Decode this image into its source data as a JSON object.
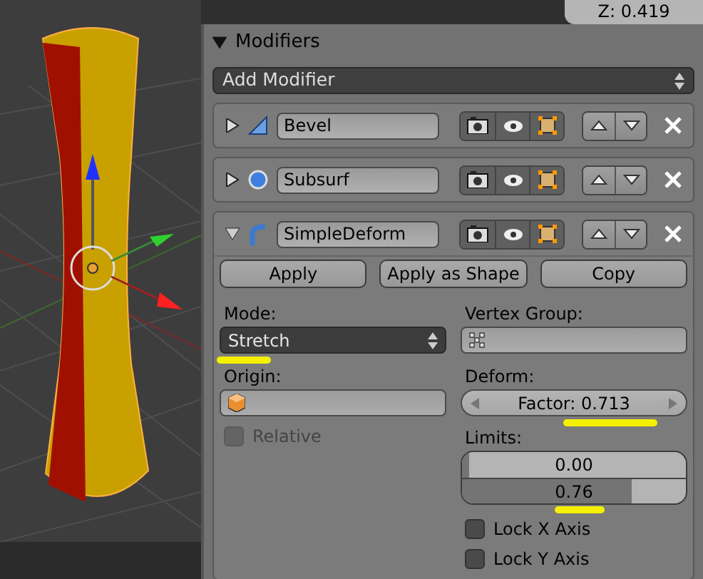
{
  "top_bar": {
    "z_field": "Z: 0.419"
  },
  "panel": {
    "title": "Modifiers",
    "expanded": true,
    "add_button": "Add Modifier",
    "modifiers": [
      {
        "name": "Bevel",
        "kind": "bevel",
        "expanded": false
      },
      {
        "name": "Subsurf",
        "kind": "subsurf",
        "expanded": false
      },
      {
        "name": "SimpleDeform",
        "kind": "deform",
        "expanded": true
      }
    ],
    "actions": [
      "Apply",
      "Apply as Shape",
      "Copy"
    ],
    "mode": {
      "label": "Mode:",
      "value": "Stretch"
    },
    "vertex_group": {
      "label": "Vertex Group:"
    },
    "origin": {
      "label": "Origin:"
    },
    "relative": {
      "label": "Relative",
      "checked": false,
      "disabled": true
    },
    "deform": {
      "label": "Deform:",
      "factor": "Factor: 0.713"
    },
    "limits": {
      "label": "Limits:",
      "items": [
        {
          "value": "0.00",
          "level": 0.03
        },
        {
          "value": "0.76",
          "level": 0.76
        }
      ]
    },
    "locks": [
      {
        "label": "Lock X Axis",
        "checked": false
      },
      {
        "label": "Lock Y Axis",
        "checked": false
      }
    ]
  }
}
